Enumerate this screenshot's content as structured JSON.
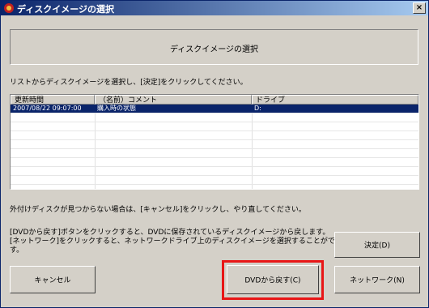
{
  "window": {
    "title": "ディスクイメージの選択",
    "close_label": "×"
  },
  "header": {
    "title": "ディスクイメージの選択"
  },
  "instructions": {
    "text": "リストからディスクイメージを選択し、[決定]をクリックしてください。"
  },
  "list": {
    "columns": [
      "更新時間",
      "（名前）コメント",
      "ドライブ"
    ],
    "rows": [
      {
        "time": "2007/08/22 09:07:00",
        "comment": "購入時の状態",
        "drive": "D:",
        "selected": true
      }
    ]
  },
  "notes": {
    "external_disk": "外付けディスクが見つからない場合は、[キャンセル]をクリックし、やり直してください。",
    "line1": "[DVDから戻す]ボタンをクリックすると、DVDに保存されているディスクイメージから戻します。",
    "line2": "[ネットワーク]をクリックすると、ネットワークドライブ上のディスクイメージを選択することができま",
    "line3": "す。"
  },
  "buttons": {
    "ok": "決定(D)",
    "cancel": "キャンセル",
    "dvd": "DVDから戻す(C)",
    "network": "ネットワーク(N)"
  },
  "colors": {
    "highlight": "#e81616",
    "selection": "#0a246a",
    "title_gradient_start": "#0a246a"
  }
}
